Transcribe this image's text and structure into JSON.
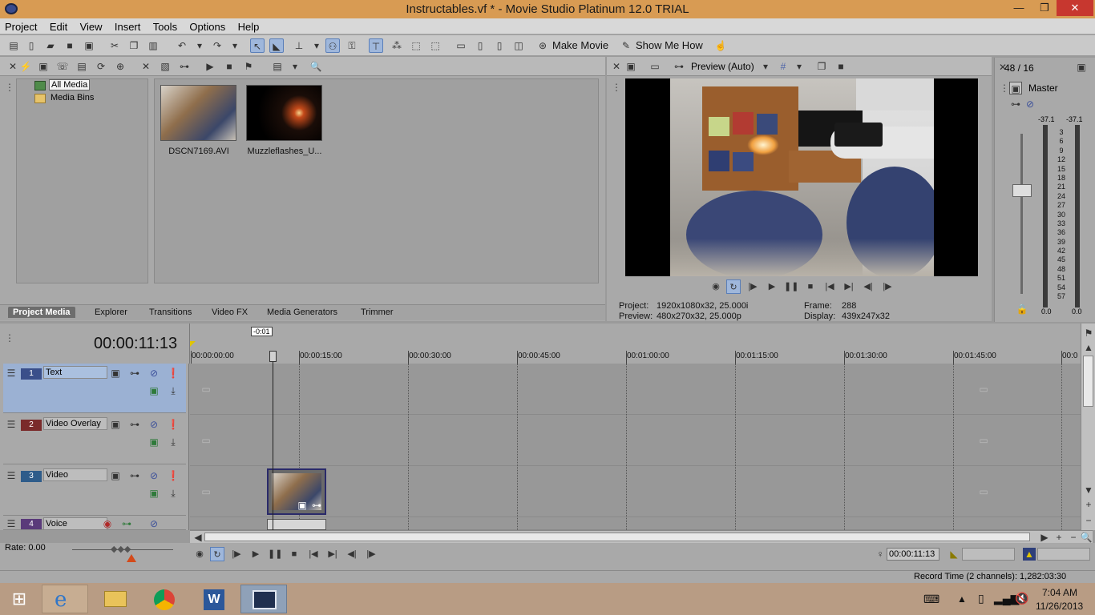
{
  "window": {
    "title": "Instructables.vf * - Movie Studio Platinum 12.0 TRIAL",
    "minimize": "—",
    "maximize": "❐",
    "close": "✕"
  },
  "menu": [
    "Project",
    "Edit",
    "View",
    "Insert",
    "Tools",
    "Options",
    "Help"
  ],
  "toolbar": {
    "make_movie": "Make Movie",
    "show_me_how": "Show Me How"
  },
  "media_tree": {
    "items": [
      "All Media",
      "Media Bins"
    ]
  },
  "media_files": [
    {
      "name": "DSCN7169.AVI"
    },
    {
      "name": "Muzzleflashes_U..."
    }
  ],
  "panel_tabs": [
    "Project Media",
    "Explorer",
    "Transitions",
    "Video FX",
    "Media Generators",
    "Trimmer"
  ],
  "preview": {
    "mode": "Preview (Auto)",
    "project_label": "Project:",
    "project_value": "1920x1080x32, 25.000i",
    "preview_label": "Preview:",
    "preview_value": "480x270x32, 25.000p",
    "frame_label": "Frame:",
    "frame_value": "288",
    "display_label": "Display:",
    "display_value": "439x247x32"
  },
  "mixer": {
    "counter": "48 / 16",
    "master": "Master",
    "peak_left": "-37.1",
    "peak_right": "-37.1",
    "scale": [
      "3",
      "6",
      "9",
      "12",
      "15",
      "18",
      "21",
      "24",
      "27",
      "30",
      "33",
      "36",
      "39",
      "42",
      "45",
      "48",
      "51",
      "54",
      "57"
    ],
    "bottom_left": "0.0",
    "bottom_right": "0.0"
  },
  "timeline": {
    "current_time": "00:00:11:13",
    "offset_marker": "-0:01",
    "ruler": [
      "00:00:00:00",
      "00:00:15:00",
      "00:00:30:00",
      "00:00:45:00",
      "00:01:00:00",
      "00:01:15:00",
      "00:01:30:00",
      "00:01:45:00",
      "00:0"
    ],
    "tracks": [
      {
        "num": "1",
        "name": "Text"
      },
      {
        "num": "2",
        "name": "Video Overlay"
      },
      {
        "num": "3",
        "name": "Video"
      },
      {
        "num": "4",
        "name": "Voice"
      }
    ],
    "rate": "Rate: 0.00",
    "cursor_time": "00:00:11:13"
  },
  "statusbar": {
    "record_time": "Record Time (2 channels): 1,282:03:30"
  },
  "taskbar": {
    "time": "7:04 AM",
    "date": "11/26/2013"
  },
  "colors": {
    "titlebar": "#d89b53",
    "track_text": "#3a4f8a",
    "track_overlay": "#7a2a2a",
    "track_video": "#2e5c8a",
    "track_voice": "#5a3a7a",
    "selection": "#9bb1d3"
  }
}
